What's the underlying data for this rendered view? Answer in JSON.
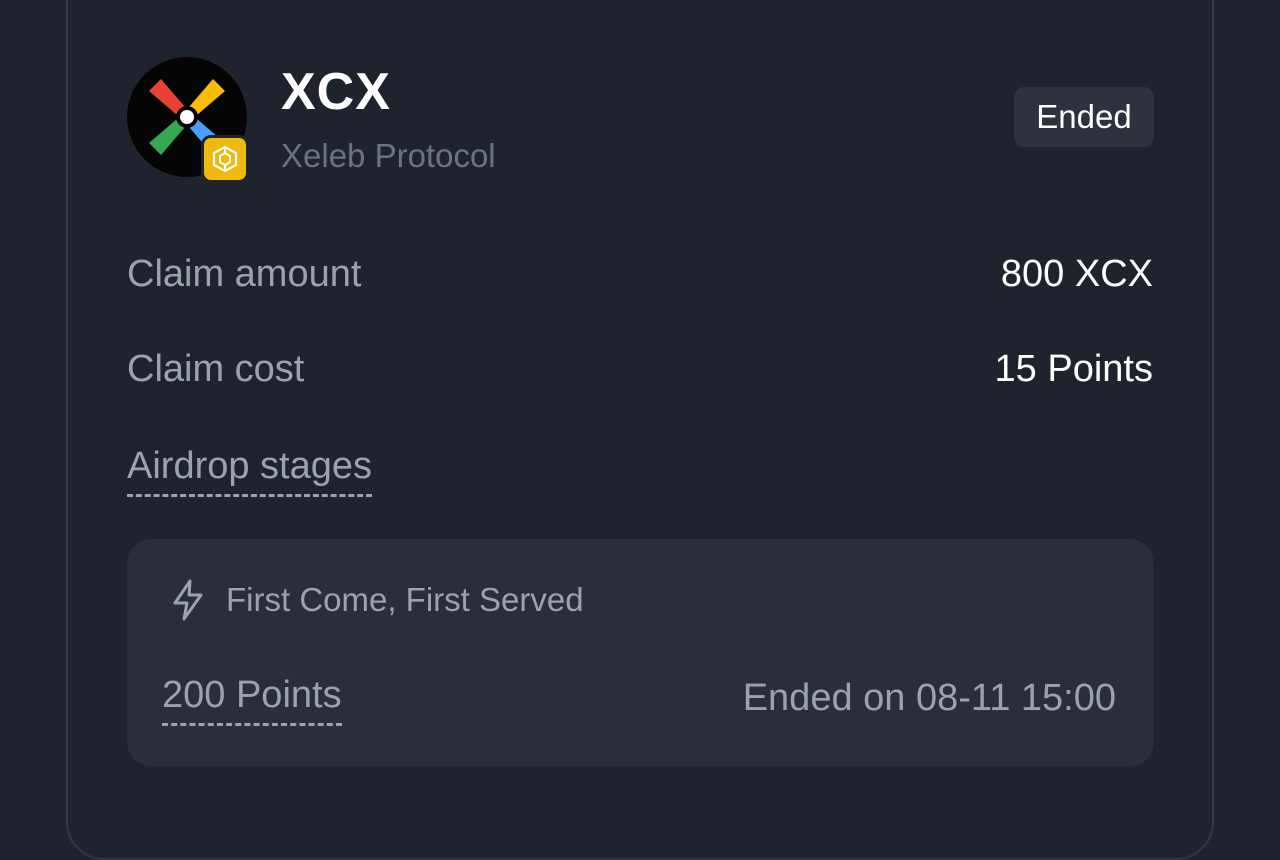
{
  "token": {
    "symbol": "XCX",
    "name": "Xeleb Protocol",
    "logo_icon": "xeleb-logo-icon",
    "chain_icon": "bnb-chain-icon"
  },
  "status": "Ended",
  "details": {
    "claim_amount_label": "Claim amount",
    "claim_amount_value": "800 XCX",
    "claim_cost_label": "Claim cost",
    "claim_cost_value": "15 Points",
    "airdrop_stages_label": "Airdrop stages"
  },
  "stage": {
    "icon": "lightning-icon",
    "type": "First Come, First Served",
    "points": "200 Points",
    "ended": "Ended on 08-11 15:00"
  },
  "colors": {
    "background": "#1f232e",
    "stage_background": "#2a2e39",
    "badge_background": "#2d323e",
    "chain_badge": "#f0b90b",
    "text_primary": "#ffffff",
    "text_secondary": "#9ba1ad"
  }
}
